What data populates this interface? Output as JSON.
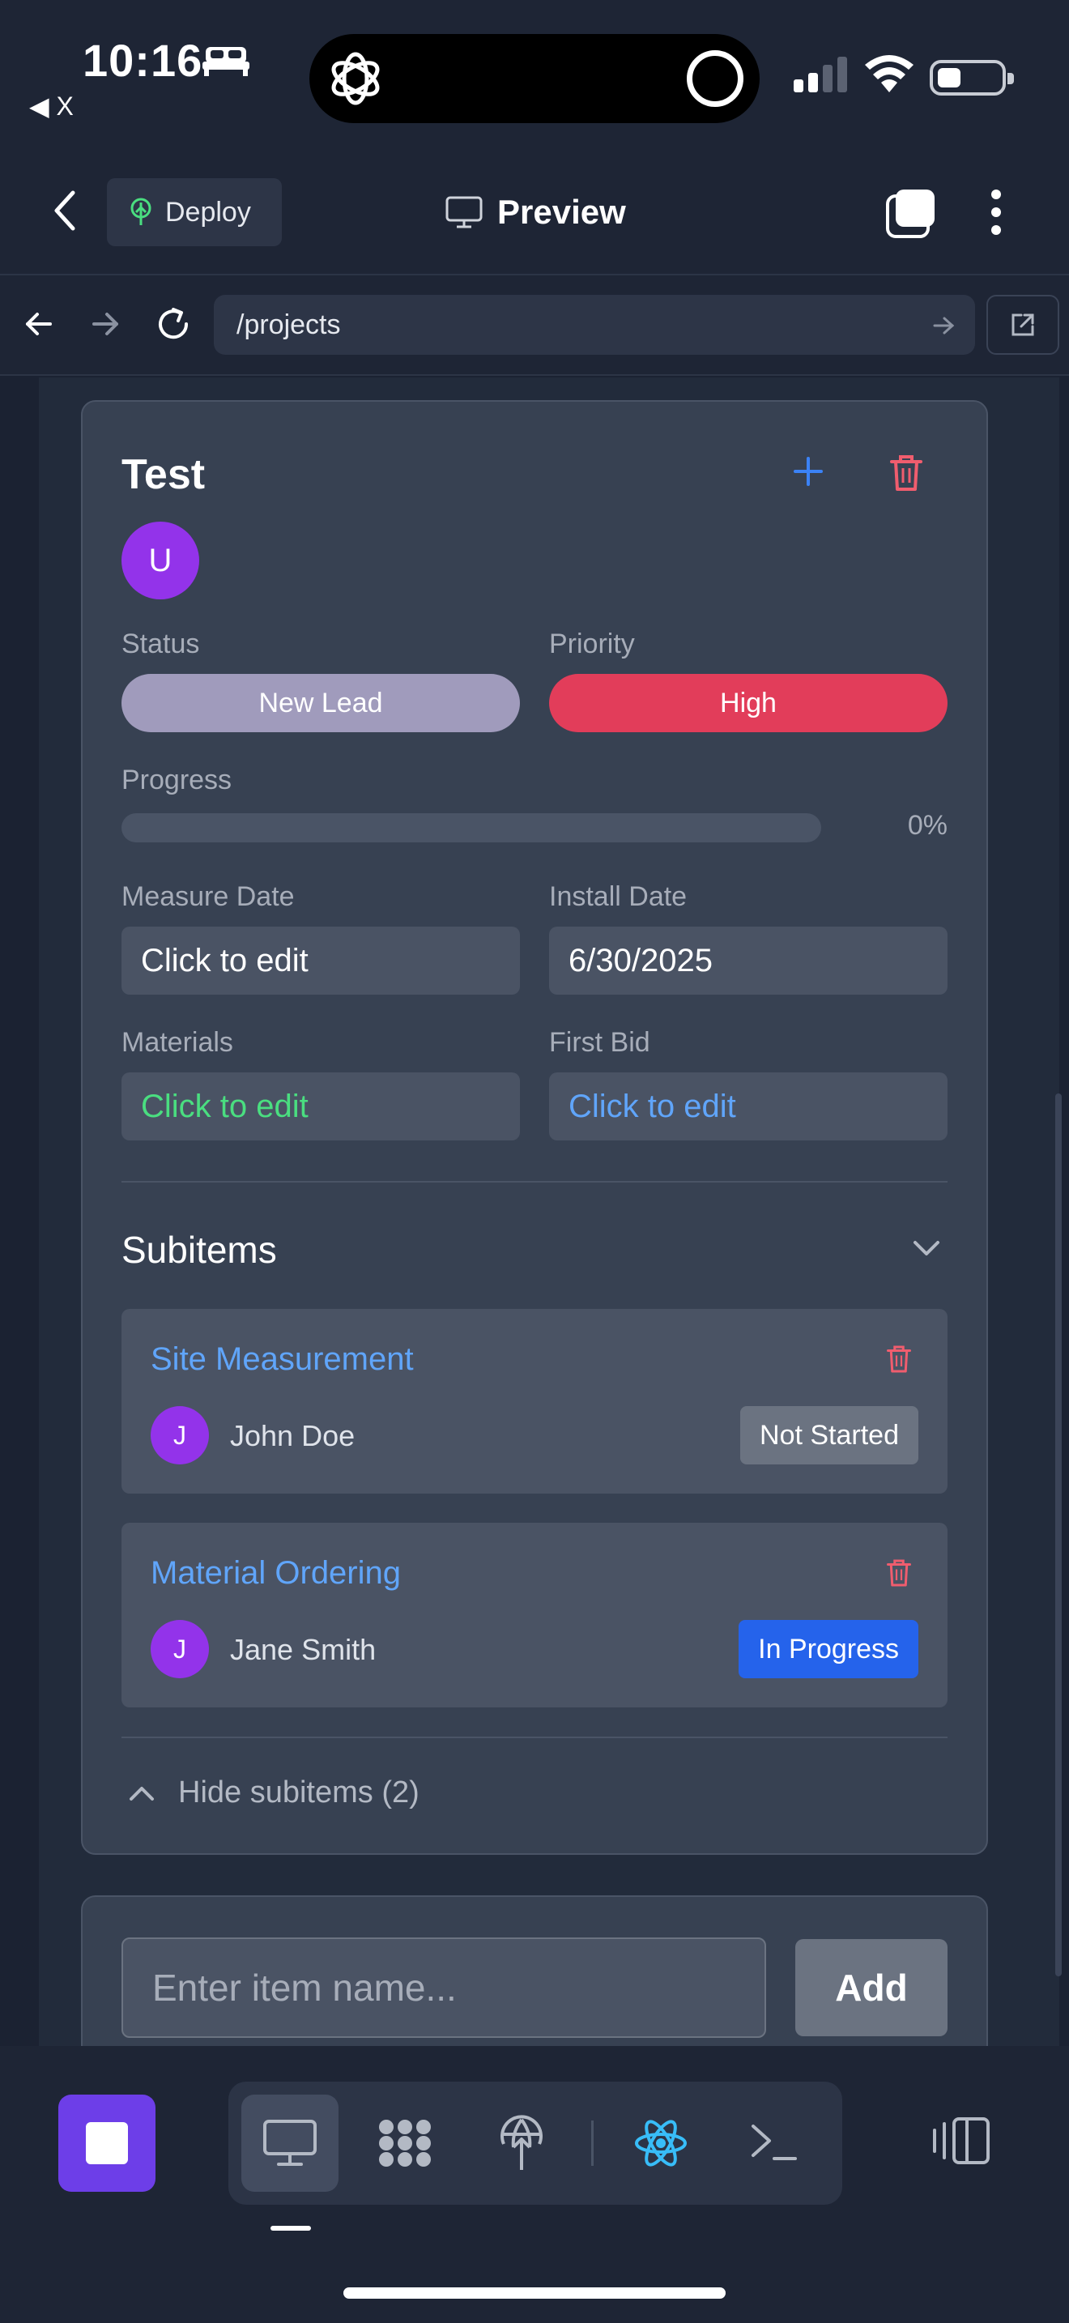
{
  "status_bar": {
    "time": "10:16",
    "back_app": "◀ X"
  },
  "header": {
    "deploy_label": "Deploy",
    "preview_label": "Preview"
  },
  "url_bar": {
    "path": "/projects"
  },
  "card": {
    "title": "Test",
    "avatar_initial": "U",
    "status_label": "Status",
    "status_value": "New Lead",
    "priority_label": "Priority",
    "priority_value": "High",
    "progress_label": "Progress",
    "progress_value_text": "0%",
    "progress_value": 0,
    "measure_date_label": "Measure Date",
    "measure_date_value": "Click to edit",
    "install_date_label": "Install Date",
    "install_date_value": "6/30/2025",
    "materials_label": "Materials",
    "materials_value": "Click to edit",
    "first_bid_label": "First Bid",
    "first_bid_value": "Click to edit",
    "subitems_title": "Subitems",
    "subitems": [
      {
        "title": "Site Measurement",
        "avatar_initial": "J",
        "assignee": "John Doe",
        "status": "Not Started"
      },
      {
        "title": "Material Ordering",
        "avatar_initial": "J",
        "assignee": "Jane Smith",
        "status": "In Progress"
      }
    ],
    "hide_subitems_label": "Hide subitems (2)"
  },
  "add_item": {
    "placeholder": "Enter item name...",
    "button_label": "Add"
  },
  "colors": {
    "accent_purple": "#9333ea",
    "priority_high": "#e23d5a",
    "status_new_lead": "#a09bbc",
    "link_blue": "#60a5fa",
    "materials_green": "#4ade80",
    "in_progress_blue": "#2563eb",
    "stop_button": "#6d3ee8"
  },
  "icons": [
    "bed-icon",
    "openai-logo-icon",
    "signal-icon",
    "wifi-icon",
    "battery-icon",
    "chevron-left-icon",
    "deploy-icon",
    "monitor-icon",
    "tabs-icon",
    "more-vertical-icon",
    "arrow-left-icon",
    "arrow-right-icon",
    "reload-icon",
    "external-link-icon",
    "plus-icon",
    "trash-icon",
    "chevron-down-icon",
    "chevron-up-icon",
    "stop-icon",
    "desktop-icon",
    "workspace-icon",
    "deploy-tree-icon",
    "react-icon",
    "terminal-icon",
    "sidebar-toggle-icon"
  ]
}
